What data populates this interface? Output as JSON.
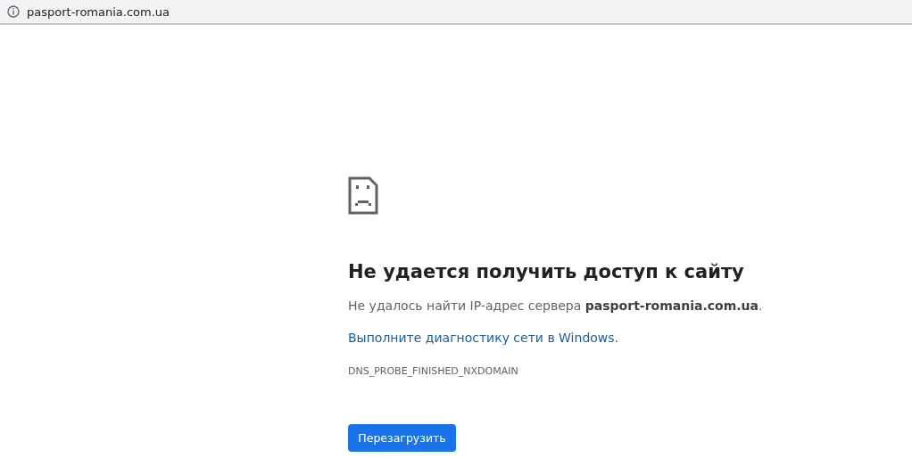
{
  "address_bar": {
    "url": "pasport-romania.com.ua"
  },
  "error": {
    "title": "Не удается получить доступ к сайту",
    "message": "Не удалось найти IP-адрес сервера **pasport-romania.com.ua**.",
    "link": "Выполните диагностику сети в Windows.",
    "code": "DNS_PROBE_FINISHED_NXDOMAIN",
    "button": "Перезагрузить"
  }
}
